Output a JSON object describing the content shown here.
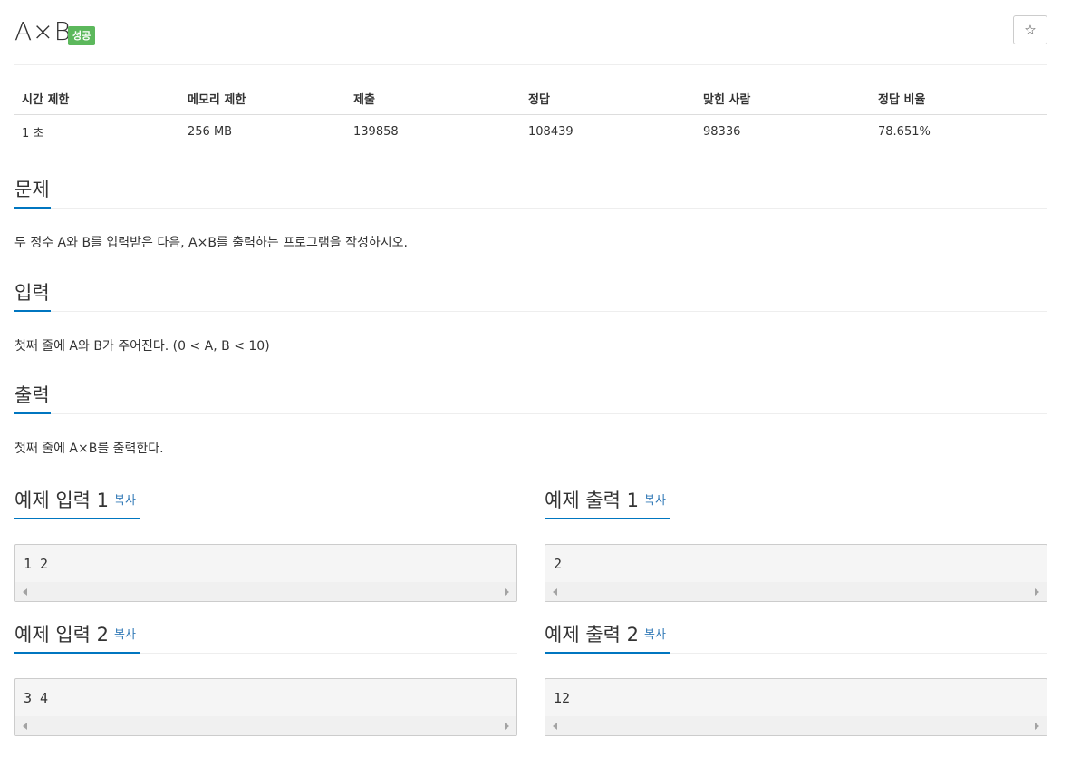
{
  "problem": {
    "title": "A×B",
    "badge": "성공",
    "star_icon": "☆"
  },
  "colors": {
    "badge": "#5cb85c",
    "accent_underline": "#0076c0",
    "link": "#337ab7",
    "sample_bg": "#f5f5f5"
  },
  "info": {
    "headers": [
      "시간 제한",
      "메모리 제한",
      "제출",
      "정답",
      "맞힌 사람",
      "정답 비율"
    ],
    "values": [
      "1 초",
      "256 MB",
      "139858",
      "108439",
      "98336",
      "78.651%"
    ]
  },
  "sections": {
    "description": {
      "heading": "문제",
      "text": "두 정수 A와 B를 입력받은 다음, A×B를 출력하는 프로그램을 작성하시오."
    },
    "input": {
      "heading": "입력",
      "text": "첫째 줄에 A와 B가 주어진다. (0 < A, B < 10)"
    },
    "output": {
      "heading": "출력",
      "text": "첫째 줄에 A×B를 출력한다."
    }
  },
  "samples": {
    "copy_label": "복사",
    "input1": {
      "heading": "예제 입력 1",
      "value": "1 2"
    },
    "output1": {
      "heading": "예제 출력 1",
      "value": "2"
    },
    "input2": {
      "heading": "예제 입력 2",
      "value": "3 4"
    },
    "output2": {
      "heading": "예제 출력 2",
      "value": "12"
    }
  }
}
